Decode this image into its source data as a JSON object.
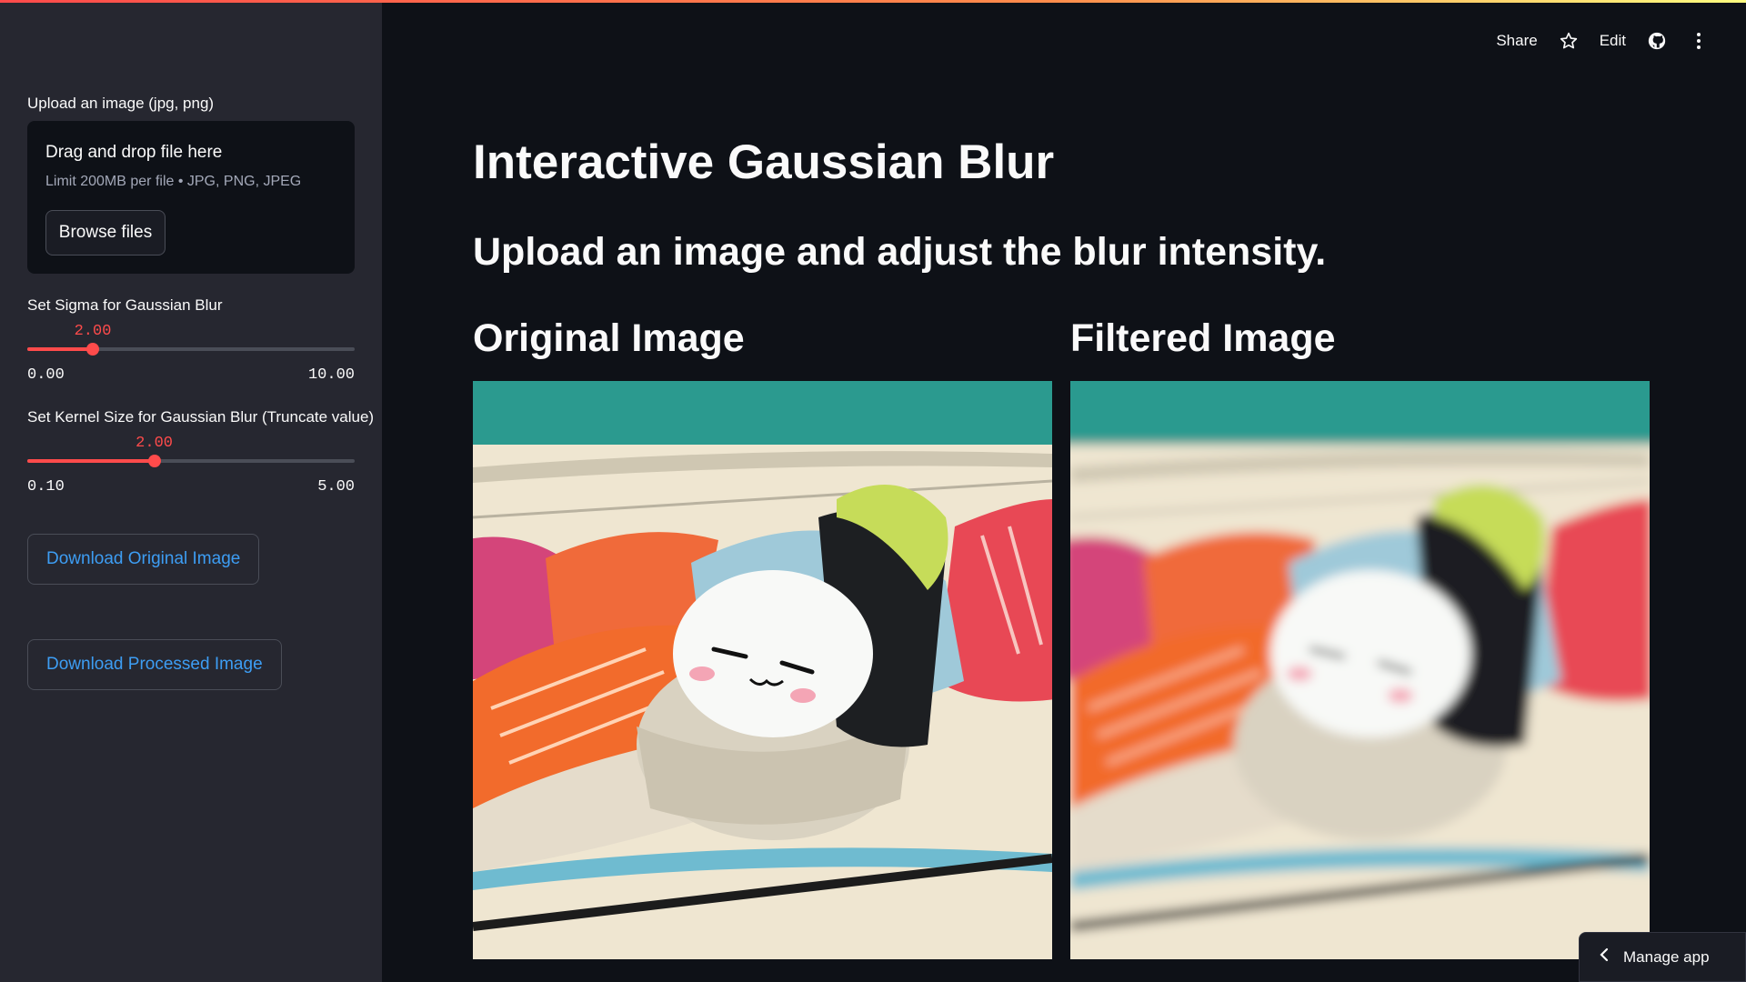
{
  "toolbar": {
    "share_label": "Share",
    "edit_label": "Edit",
    "icons": [
      "star-icon",
      "github-icon",
      "more-vertical-icon"
    ]
  },
  "sidebar": {
    "upload_label": "Upload an image (jpg, png)",
    "dropzone_title": "Drag and drop file here",
    "dropzone_sub": "Limit 200MB per file • JPG, PNG, JPEG",
    "browse_label": "Browse files",
    "sigma": {
      "label": "Set Sigma for Gaussian Blur",
      "value": 2.0,
      "value_text": "2.00",
      "min": 0.0,
      "min_text": "0.00",
      "max": 10.0,
      "max_text": "10.00"
    },
    "kernel": {
      "label": "Set Kernel Size for Gaussian Blur (Truncate value)",
      "value": 2.0,
      "value_text": "2.00",
      "min": 0.1,
      "min_text": "0.10",
      "max": 5.0,
      "max_text": "5.00"
    },
    "download_original_label": "Download Original Image",
    "download_processed_label": "Download Processed Image"
  },
  "main": {
    "title": "Interactive Gaussian Blur",
    "subheading": "Upload an image and adjust the blur intensity.",
    "original_heading": "Original Image",
    "filtered_heading": "Filtered Image"
  },
  "manage_app_label": "Manage app",
  "colors": {
    "accent": "#ff4b4b",
    "link": "#3d9df3",
    "sidebar_bg": "#262730",
    "main_bg": "#0e1117"
  }
}
